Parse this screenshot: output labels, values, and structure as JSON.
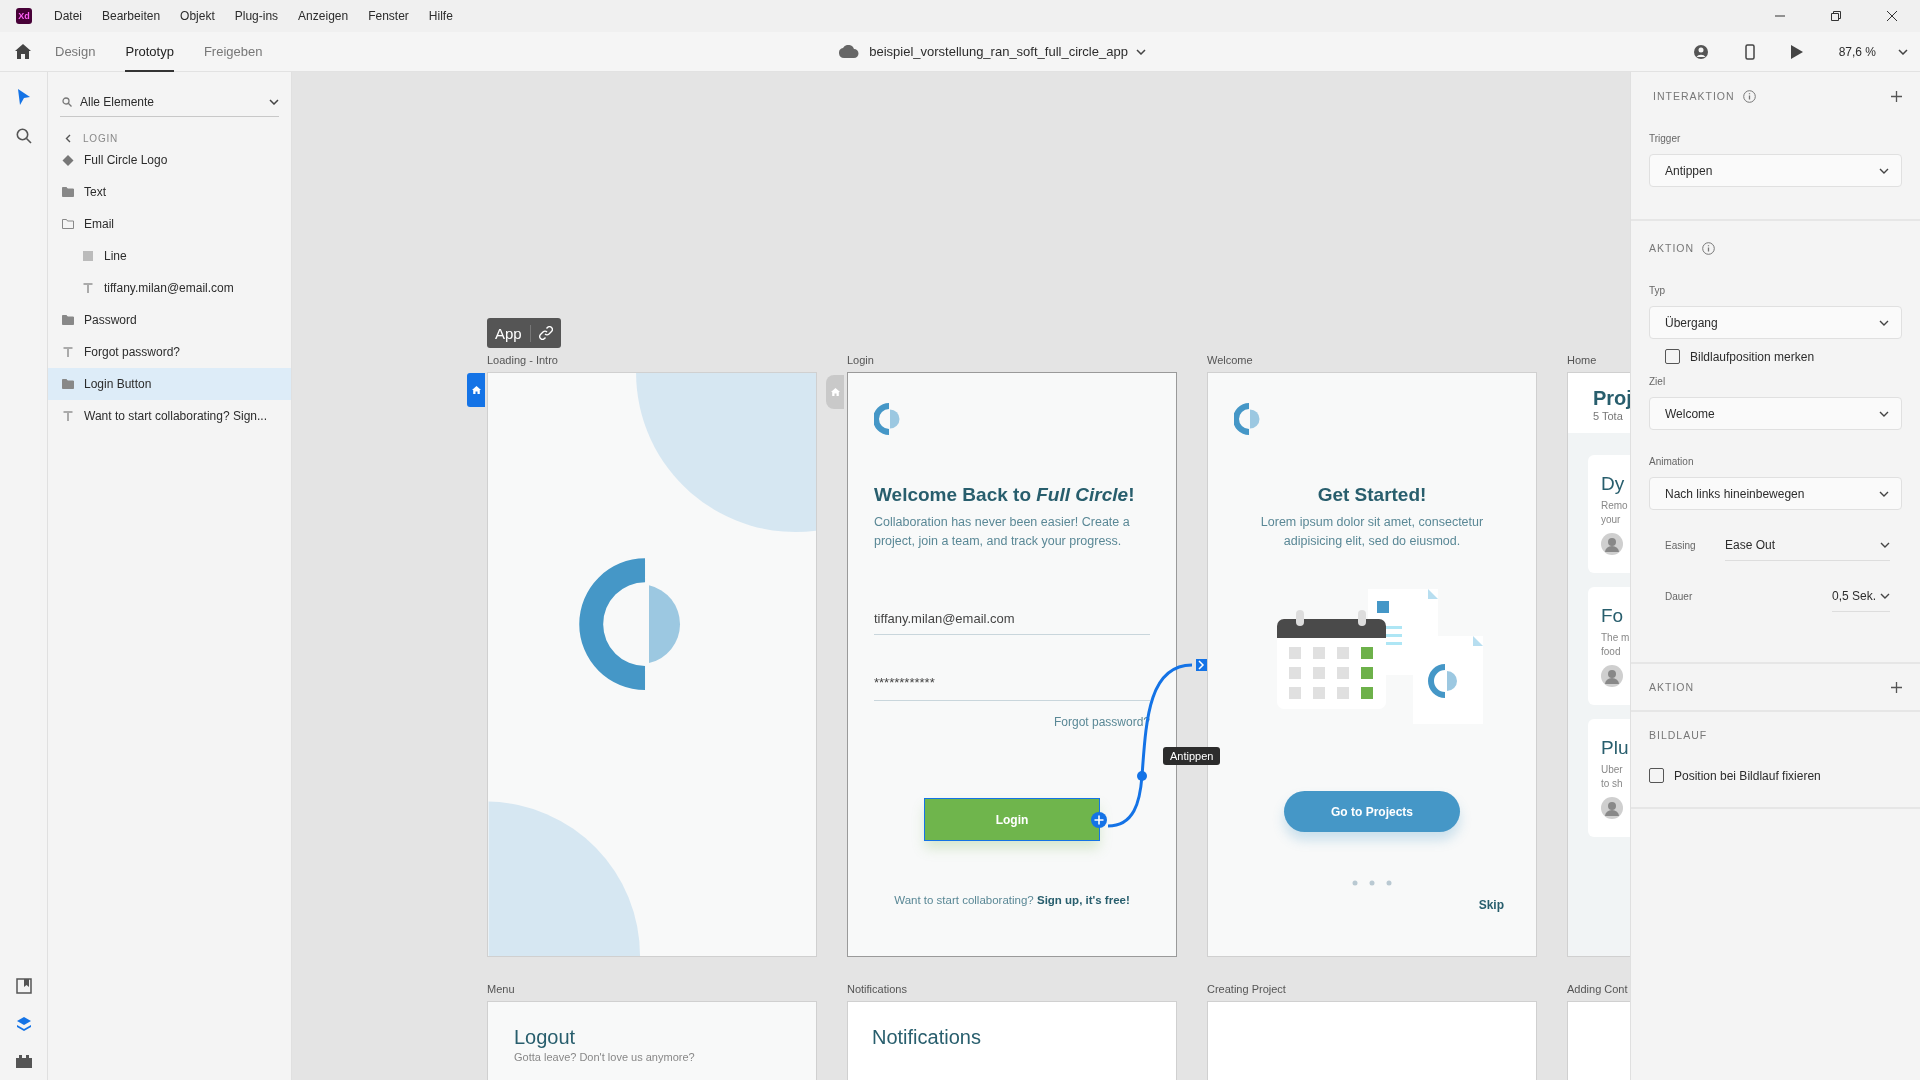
{
  "menu_bar": {
    "app_logo": "Xd",
    "items": [
      "Datei",
      "Bearbeiten",
      "Objekt",
      "Plug-ins",
      "Anzeigen",
      "Fenster",
      "Hilfe"
    ]
  },
  "toolbar": {
    "tabs": [
      {
        "label": "Design",
        "selected": false
      },
      {
        "label": "Prototyp",
        "selected": true
      },
      {
        "label": "Freigeben",
        "selected": false
      }
    ],
    "document_title": "beispiel_vorstellung_ran_soft_full_circle_app",
    "zoom": "87,6 %"
  },
  "tool_rail": {
    "top": [
      {
        "kind": "select",
        "selected": true
      },
      {
        "kind": "search",
        "selected": false
      }
    ],
    "bottom": [
      {
        "kind": "assets",
        "selected": false
      },
      {
        "kind": "layers",
        "selected": true
      },
      {
        "kind": "plugins",
        "selected": false
      }
    ]
  },
  "layers": {
    "filter": "Alle Elemente",
    "breadcrumb": "LOGIN",
    "items": [
      {
        "name": "Full Circle Logo",
        "kind": "symbol",
        "selected": false
      },
      {
        "name": "Text",
        "kind": "group",
        "expanded": false,
        "selected": false
      },
      {
        "name": "Email",
        "kind": "group",
        "expanded": true,
        "selected": false,
        "children": [
          {
            "name": "Line",
            "kind": "shape",
            "selected": false
          },
          {
            "name": "tiffany.milan@email.com",
            "kind": "text",
            "selected": false
          }
        ]
      },
      {
        "name": "Password",
        "kind": "group",
        "expanded": false,
        "selected": false
      },
      {
        "name": "Forgot password?",
        "kind": "text",
        "selected": false
      },
      {
        "name": "Login Button",
        "kind": "group",
        "expanded": false,
        "selected": true
      },
      {
        "name": "Want to start collaborating? Sign...",
        "kind": "text",
        "selected": false
      }
    ]
  },
  "canvas": {
    "flow_label": "App",
    "trigger_tooltip": "Antippen",
    "artboards": [
      {
        "kind": "intro",
        "name": "Loading - Intro",
        "home_start": true
      },
      {
        "kind": "login",
        "name": "Login",
        "home_start": false,
        "heading": "Welcome Back to *Full Circle*!",
        "body": "Collaboration has never been easier! Create a project, join a team, and track your progress.",
        "email": "tiffany.milan@email.com",
        "password": "************",
        "forgot": "Forgot password?",
        "button": "Login",
        "button_selected": true,
        "footer": "Want to start collaborating? **Sign up, it's free!**"
      },
      {
        "kind": "welcome",
        "name": "Welcome",
        "heading": "Get Started!",
        "body": "Lorem ipsum dolor sit amet, consectetur adipisicing elit, sed do eiusmod.",
        "button": "Go to Projects",
        "skip": "Skip"
      },
      {
        "kind": "home",
        "name": "Home",
        "heading": "Proj",
        "subheading": "5 Tota",
        "cards": [
          {
            "title": "Dy",
            "lines": [
              "Remo",
              "your"
            ]
          },
          {
            "title": "Fo",
            "lines": [
              "The m",
              "food"
            ]
          },
          {
            "title": "Plu",
            "lines": [
              "Uber",
              "to sh"
            ]
          }
        ]
      },
      {
        "kind": "menu",
        "name": "Menu",
        "heading": "Logout",
        "subtitle": "Gotta leave? Don't love us anymore?"
      },
      {
        "kind": "notifications",
        "name": "Notifications",
        "heading": "Notifications"
      },
      {
        "kind": "blank",
        "name": "Creating Project"
      },
      {
        "kind": "blank",
        "name": "Adding Cont"
      }
    ]
  },
  "properties": {
    "sections": [
      {
        "kind": "interaction",
        "title": "INTERAKTION",
        "fields": [
          {
            "kind": "dropdown",
            "label": "Trigger",
            "value": "Antippen"
          }
        ]
      },
      {
        "kind": "action",
        "title": "AKTION",
        "fields": [
          {
            "kind": "dropdown",
            "label": "Typ",
            "value": "Übergang"
          },
          {
            "kind": "checkbox",
            "label": "Bildlaufposition merken",
            "checked": false
          },
          {
            "kind": "dropdown",
            "label": "Ziel",
            "value": "Welcome"
          },
          {
            "kind": "dropdown",
            "label": "Animation",
            "value": "Nach links hineinbewegen"
          },
          {
            "kind": "inline",
            "label": "Easing",
            "value": "Ease Out"
          },
          {
            "kind": "inline_short",
            "label": "Dauer",
            "value": "0,5 Sek."
          }
        ]
      },
      {
        "kind": "add_action",
        "title": "AKTION"
      },
      {
        "kind": "scroll",
        "title": "BILDLAUF",
        "fields": [
          {
            "kind": "checkbox",
            "label": "Position bei Bildlauf fixieren",
            "checked": false
          }
        ]
      }
    ]
  }
}
